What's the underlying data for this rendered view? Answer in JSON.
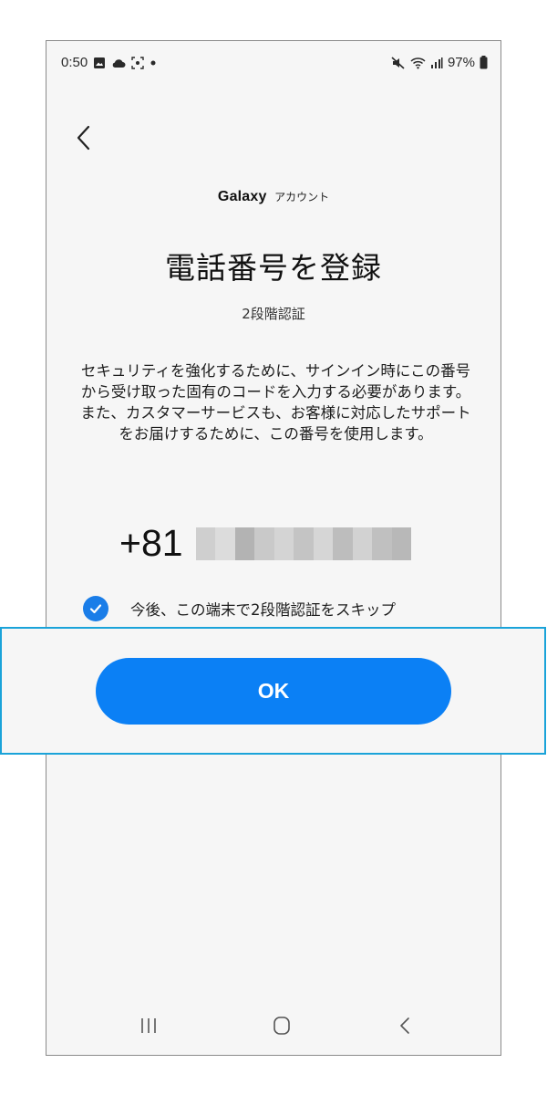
{
  "status_bar": {
    "time": "0:50",
    "battery": "97%",
    "icons": [
      "gallery-icon",
      "cloud-icon",
      "screenshot-icon",
      "dot-icon",
      "mute-icon",
      "wifi-icon",
      "signal-icon",
      "battery-icon"
    ]
  },
  "header": {
    "back_icon": "chevron-left-icon"
  },
  "brand": {
    "name": "Galaxy",
    "suffix": "アカウント"
  },
  "page": {
    "title": "電話番号を登録",
    "subtitle": "2段階認証",
    "description": "セキュリティを強化するために、サインイン時にこの番号から受け取った固有のコードを入力する必要があります。また、カスタマーサービスも、お客様に対応したサポートをお届けするために、この番号を使用します。"
  },
  "phone": {
    "country_code": "+81",
    "number_masked": true
  },
  "skip_option": {
    "label": "今後、この端末で2段階認証をスキップ",
    "checked": true
  },
  "actions": {
    "ok_label": "OK"
  },
  "nav_bar": {
    "icons": [
      "recent-apps-icon",
      "home-icon",
      "back-icon"
    ]
  },
  "colors": {
    "accent": "#0b80f5",
    "checkbox": "#1a7de8",
    "highlight_border": "#1aa3d9",
    "background": "#f6f6f6"
  }
}
